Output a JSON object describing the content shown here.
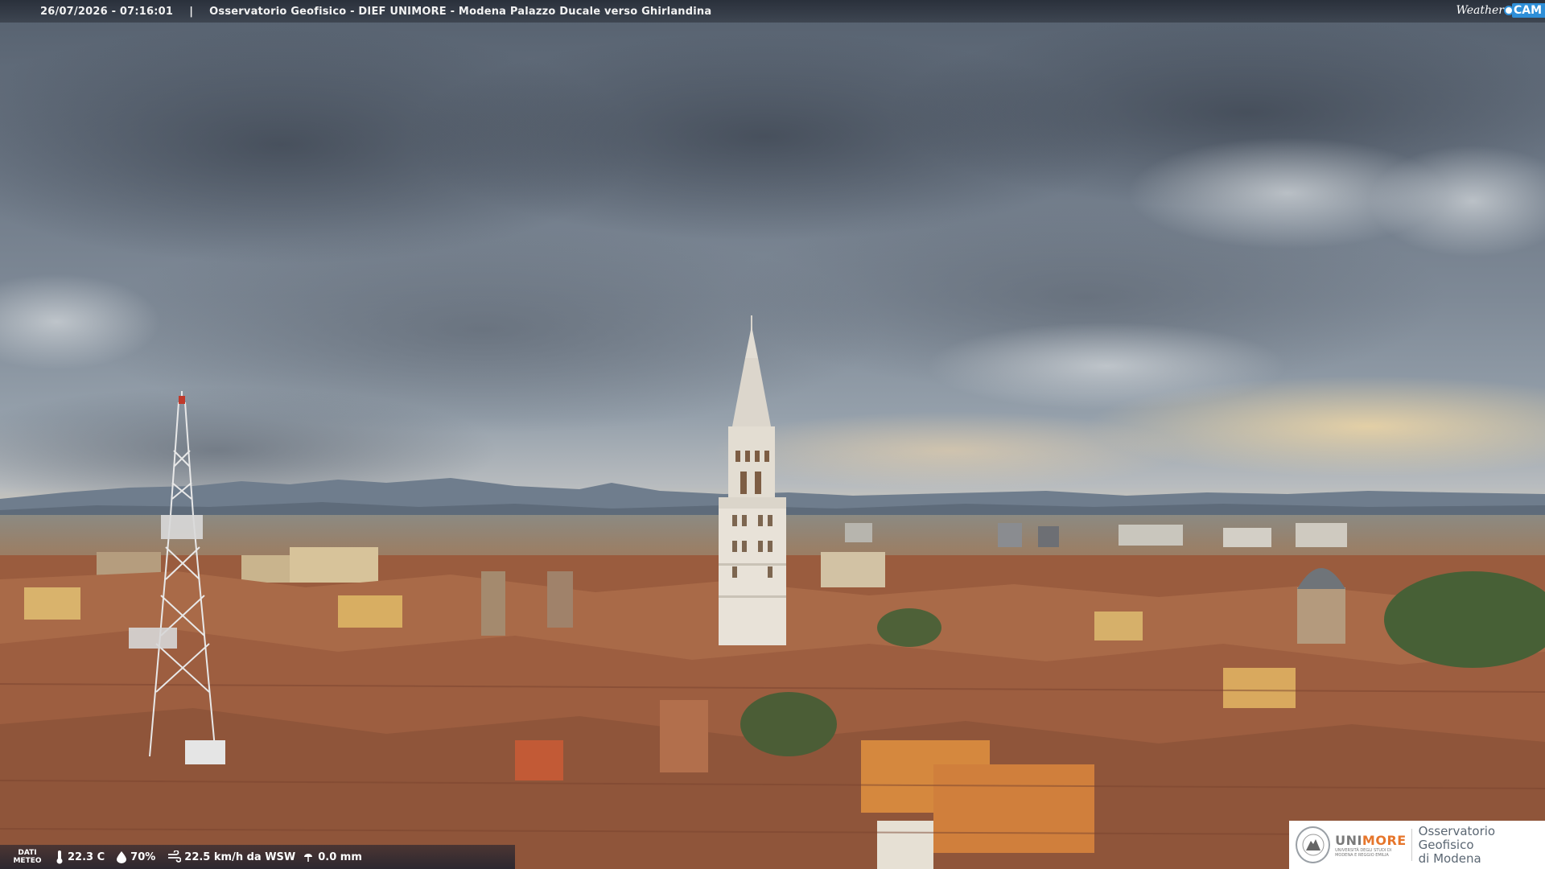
{
  "header": {
    "datetime": "26/07/2026 - 07:16:01",
    "separator": "|",
    "title": "Osservatorio Geofisico - DIEF UNIMORE - Modena Palazzo Ducale verso Ghirlandina"
  },
  "brand": {
    "weathercam_word": "Weather",
    "weathercam_cam": "CAM",
    "accent_color": "#2f8fd8"
  },
  "weather": {
    "label_line1": "DATI",
    "label_line2": "METEO",
    "temperature": "22.3 C",
    "humidity": "70%",
    "wind": "22.5 km/h da WSW",
    "rain": "0.0 mm",
    "icons": [
      "thermometer-icon",
      "drop-icon",
      "wind-icon",
      "rain-icon"
    ]
  },
  "footer_logo": {
    "name_part1": "UNI",
    "name_part2": "MORE",
    "subtitle": "UNIVERSITÀ DEGLI STUDI DI MODENA E REGGIO EMILIA",
    "observatory_line1": "Osservatorio Geofisico",
    "observatory_line2": "di Modena",
    "accent_color": "#e6762c"
  }
}
